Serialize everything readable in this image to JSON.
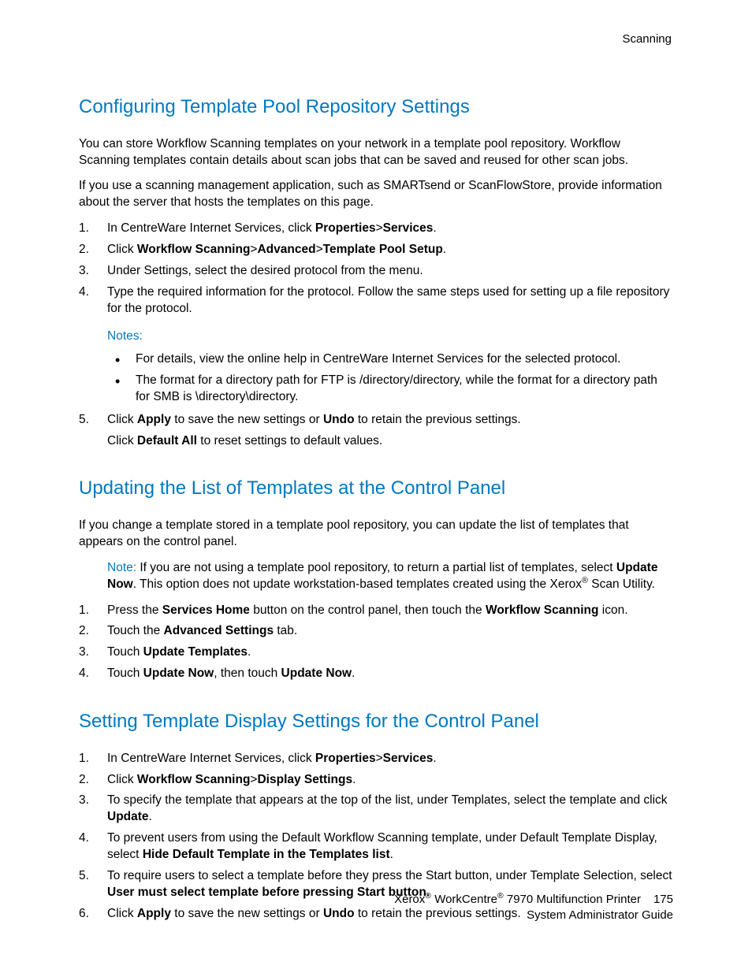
{
  "header": {
    "section": "Scanning"
  },
  "section1": {
    "heading": "Configuring Template Pool Repository Settings",
    "para1": "You can store Workflow Scanning templates on your network in a template pool repository. Workflow Scanning templates contain details about scan jobs that can be saved and reused for other scan jobs.",
    "para2": "If you use a scanning management application, such as SMARTsend or ScanFlowStore, provide information about the server that hosts the templates on this page.",
    "li1_a": "In CentreWare Internet Services, click ",
    "li1_b": "Properties",
    "li1_gt1": ">",
    "li1_c": "Services",
    "li1_d": ".",
    "li2_a": "Click ",
    "li2_b": "Workflow Scanning",
    "li2_gt1": ">",
    "li2_c": "Advanced",
    "li2_gt2": ">",
    "li2_d": "Template Pool Setup",
    "li2_e": ".",
    "li3": "Under Settings, select the desired protocol from the menu.",
    "li4": "Type the required information for the protocol. Follow the same steps used for setting up a file repository for the protocol.",
    "notes_label": "Notes:",
    "note1": "For details, view the online help in CentreWare Internet Services for the selected protocol.",
    "note2": "The format for a directory path for FTP is /directory/directory, while the format for a directory path for SMB is \\directory\\directory.",
    "li5_a": "Click ",
    "li5_b": "Apply",
    "li5_c": " to save the new settings or ",
    "li5_d": "Undo",
    "li5_e": " to retain the previous settings.",
    "li5b_a": "Click ",
    "li5b_b": "Default All",
    "li5b_c": " to reset settings to default values."
  },
  "section2": {
    "heading": "Updating the List of Templates at the Control Panel",
    "para1": "If you change a template stored in a template pool repository, you can update the list of templates that appears on the control panel.",
    "note_label": "Note:",
    "note_a": " If you are not using a template pool repository, to return a partial list of templates, select ",
    "note_b": "Update Now",
    "note_c": ". This option does not update workstation-based templates created using the Xerox",
    "note_sup": "®",
    "note_d": " Scan Utility.",
    "li1_a": "Press the ",
    "li1_b": "Services Home",
    "li1_c": " button on the control panel, then touch the ",
    "li1_d": "Workflow Scanning",
    "li1_e": " icon.",
    "li2_a": "Touch the ",
    "li2_b": "Advanced Settings",
    "li2_c": " tab.",
    "li3_a": "Touch ",
    "li3_b": "Update Templates",
    "li3_c": ".",
    "li4_a": "Touch ",
    "li4_b": "Update Now",
    "li4_c": ", then touch ",
    "li4_d": "Update Now",
    "li4_e": "."
  },
  "section3": {
    "heading": "Setting Template Display Settings for the Control Panel",
    "li1_a": "In CentreWare Internet Services, click ",
    "li1_b": "Properties",
    "li1_gt1": ">",
    "li1_c": "Services",
    "li1_d": ".",
    "li2_a": "Click ",
    "li2_b": "Workflow Scanning",
    "li2_gt1": ">",
    "li2_c": "Display Settings",
    "li2_d": ".",
    "li3_a": "To specify the template that appears at the top of the list, under Templates, select the template and click ",
    "li3_b": "Update",
    "li3_c": ".",
    "li4_a": "To prevent users from using the Default Workflow Scanning template, under Default Template Display, select ",
    "li4_b": "Hide Default Template in the Templates list",
    "li4_c": ".",
    "li5_a": "To require users to select a template before they press the Start button, under Template Selection, select ",
    "li5_b": "User must select template before pressing Start button",
    "li5_c": ".",
    "li6_a": "Click ",
    "li6_b": "Apply",
    "li6_c": " to save the new settings or ",
    "li6_d": "Undo",
    "li6_e": " to retain the previous settings."
  },
  "footer": {
    "line1_a": "Xerox",
    "line1_sup1": "®",
    "line1_b": " WorkCentre",
    "line1_sup2": "®",
    "line1_c": " 7970 Multifunction Printer",
    "page_num": "175",
    "line2": "System Administrator Guide"
  }
}
